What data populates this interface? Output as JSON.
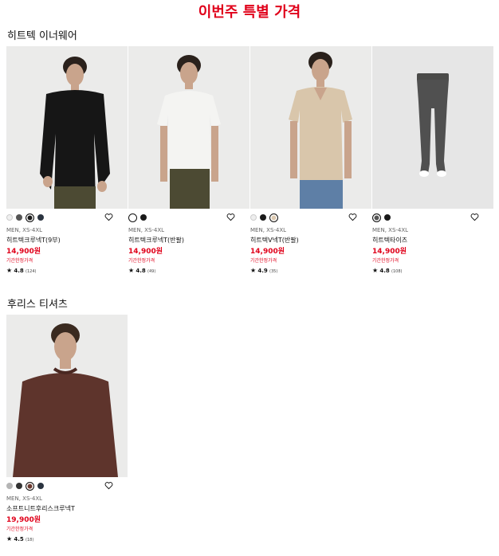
{
  "page_title": "이번주 특별 가격",
  "sections": [
    {
      "title": "히트텍 이너웨어",
      "products": [
        {
          "meta": "MEN, XS-4XL",
          "name": "히트텍크루넥T(9부)",
          "price": "14,900원",
          "promo": "기간한정가격",
          "rating": "4.8",
          "count": "(124)",
          "swatches": [
            "#f0f0f0",
            "#555555",
            "#1a1a1a",
            "#2b3440"
          ],
          "selected": 2,
          "image": "black-longsleeve-model"
        },
        {
          "meta": "MEN, XS-4XL",
          "name": "히트텍크루넥T(반팔)",
          "price": "14,900원",
          "promo": "기간한정가격",
          "rating": "4.8",
          "count": "(49)",
          "swatches": [
            "#ffffff",
            "#1a1a1a"
          ],
          "selected": 0,
          "image": "white-tshirt-model"
        },
        {
          "meta": "MEN, XS-4XL",
          "name": "히트텍V넥T(반팔)",
          "price": "14,900원",
          "promo": "기간한정가격",
          "rating": "4.9",
          "count": "(35)",
          "swatches": [
            "#eeeeee",
            "#1a1a1a",
            "#dcc9b0"
          ],
          "selected": 2,
          "image": "beige-vneck-model"
        },
        {
          "meta": "MEN, XS-4XL",
          "name": "히트텍타이즈",
          "price": "14,900원",
          "promo": "기간한정가격",
          "rating": "4.8",
          "count": "(108)",
          "swatches": [
            "#555555",
            "#1a1a1a"
          ],
          "selected": 0,
          "image": "gray-tights"
        }
      ]
    },
    {
      "title": "후리스 티셔츠",
      "products": [
        {
          "meta": "MEN, XS-4XL",
          "name": "소프트니트후리스크루넥T",
          "price": "19,900원",
          "promo": "기간한정가격",
          "rating": "4.5",
          "count": "(18)",
          "swatches": [
            "#b5b5b5",
            "#333333",
            "#6b3a30",
            "#2b3440"
          ],
          "selected": 2,
          "image": "brown-fleece-model"
        }
      ]
    }
  ],
  "icons": {
    "star": "star-icon",
    "heart": "heart-outline-icon"
  },
  "colors": {
    "accent": "#e0001a"
  }
}
